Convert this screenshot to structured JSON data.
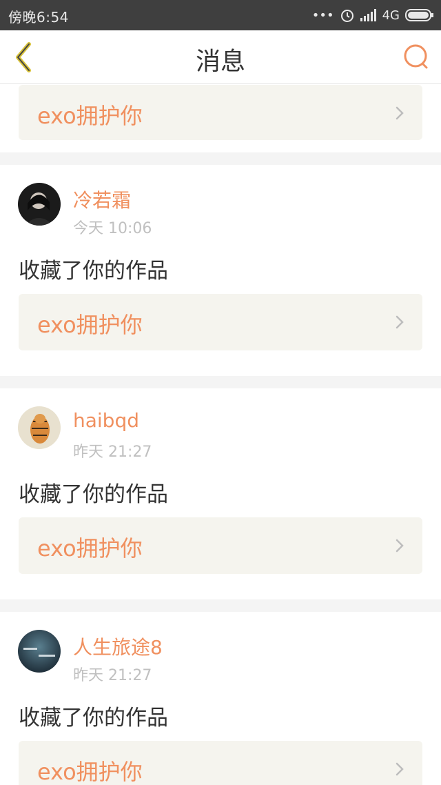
{
  "status_bar": {
    "time": "傍晚6:54",
    "network": "4G",
    "icons": [
      "more-dots-icon",
      "alarm-icon",
      "signal-icon",
      "battery-icon"
    ]
  },
  "nav": {
    "title": "消息",
    "back_icon": "chevron-left-icon",
    "search_icon": "search-icon"
  },
  "colors": {
    "accent": "#f0905f",
    "card_bg": "#f5f4ee",
    "divider": "#f4f4f4"
  },
  "top_card": {
    "work_title": "exo拥护你"
  },
  "messages": [
    {
      "user": "冷若霜",
      "time": "今天 10:06",
      "action": "收藏了你的作品",
      "work_title": "exo拥护你"
    },
    {
      "user": "haibqd",
      "time": "昨天 21:27",
      "action": "收藏了你的作品",
      "work_title": "exo拥护你"
    },
    {
      "user": "人生旅途8",
      "time": "昨天 21:27",
      "action": "收藏了你的作品",
      "work_title": "exo拥护你"
    }
  ]
}
